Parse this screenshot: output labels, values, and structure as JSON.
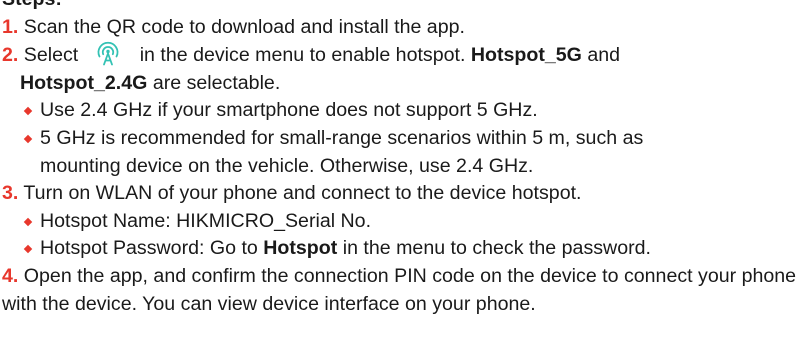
{
  "heading": "Steps:",
  "steps": [
    {
      "num": "1.",
      "text": " Scan the QR code to download and install the app."
    },
    {
      "num": "2.",
      "pre": " Select ",
      "icon": "hotspot-icon",
      "post": "in the device menu to enable hotspot. ",
      "bold1": "Hotspot_5G",
      "mid": " and",
      "bold2": "Hotspot_2.4G",
      "end": " are selectable.",
      "bullets": [
        "Use 2.4 GHz if your smartphone does not support 5 GHz.",
        "5 GHz is recommended for small-range scenarios within 5 m, such as",
        "mounting device on the vehicle. Otherwise, use 2.4 GHz."
      ]
    },
    {
      "num": "3.",
      "text": " Turn on WLAN of your phone and connect to the device hotspot.",
      "bullets": [
        "Hotspot Name: HIKMICRO_Serial No.",
        {
          "pre": "Hotspot Password: Go to ",
          "bold": "Hotspot",
          "post": " in the menu to check the password."
        }
      ]
    },
    {
      "num": "4.",
      "text": " Open the app, and confirm the connection PIN code on the device to connect your phone with the device. You can view device interface on your phone."
    }
  ],
  "colors": {
    "accent": "#e8372c",
    "icon": "#33c2b4",
    "text": "#1a1a1a"
  }
}
